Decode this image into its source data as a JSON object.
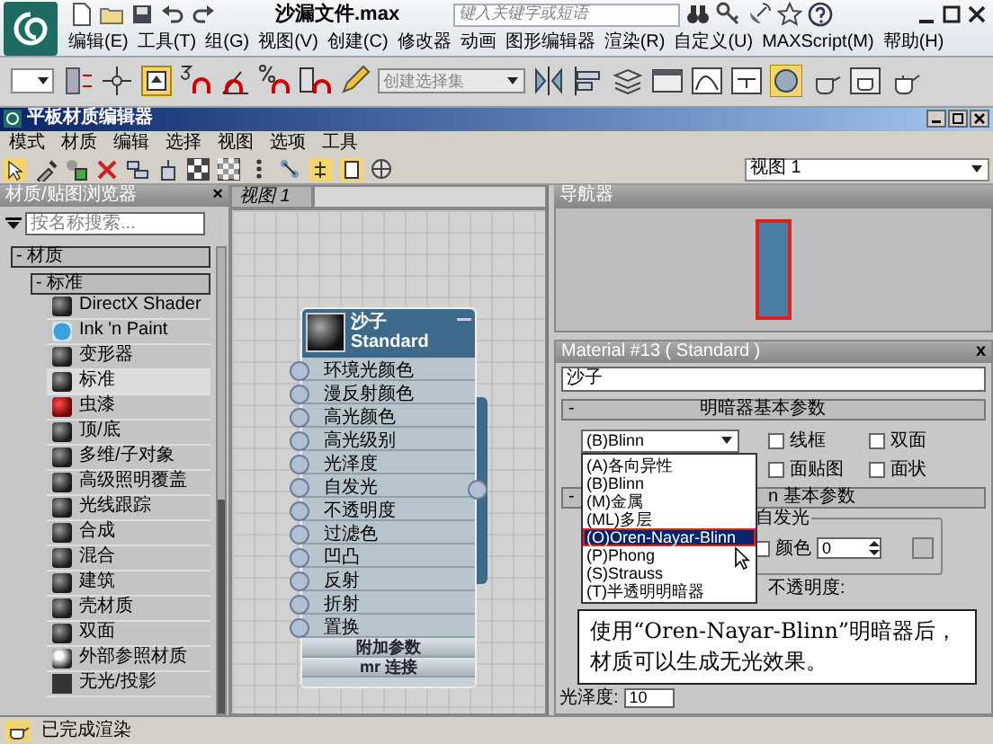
{
  "app": {
    "title": "沙漏文件.max",
    "search_placeholder": "键入关键字或短语",
    "menu": [
      "编辑(E)",
      "工具(T)",
      "组(G)",
      "视图(V)",
      "创建(C)",
      "修改器",
      "动画",
      "图形编辑器",
      "渲染(R)",
      "自定义(U)",
      "MAXScript(M)",
      "帮助(H)"
    ]
  },
  "main_toolbar": {
    "selection_set_placeholder": "创建选择集"
  },
  "editor": {
    "title": "平板材质编辑器",
    "menu": [
      "模式",
      "材质",
      "编辑",
      "选择",
      "视图",
      "选项",
      "工具"
    ],
    "view_select": "视图 1"
  },
  "browser": {
    "title": "材质/贴图浏览器",
    "close": "×",
    "search_placeholder": "按名称搜索...",
    "group": "- 材质",
    "subgroup": "- 标准",
    "items": [
      {
        "label": "DirectX Shader",
        "kind": "dark_sphere",
        "selected": false
      },
      {
        "label": "Ink 'n Paint",
        "kind": "blue_sphere",
        "selected": false
      },
      {
        "label": "变形器",
        "kind": "dark_sphere",
        "selected": false
      },
      {
        "label": "标准",
        "kind": "dark_sphere",
        "selected": true
      },
      {
        "label": "虫漆",
        "kind": "red_sphere",
        "selected": false
      },
      {
        "label": "顶/底",
        "kind": "dark_sphere",
        "selected": false
      },
      {
        "label": "多维/子对象",
        "kind": "dark_sphere",
        "selected": false
      },
      {
        "label": "高级照明覆盖",
        "kind": "dark_sphere",
        "selected": false
      },
      {
        "label": "光线跟踪",
        "kind": "dark_sphere",
        "selected": false
      },
      {
        "label": "合成",
        "kind": "dark_sphere",
        "selected": false
      },
      {
        "label": "混合",
        "kind": "dark_sphere",
        "selected": false
      },
      {
        "label": "建筑",
        "kind": "dark_sphere",
        "selected": false
      },
      {
        "label": "壳材质",
        "kind": "dark_sphere",
        "selected": false
      },
      {
        "label": "双面",
        "kind": "dark_sphere",
        "selected": false
      },
      {
        "label": "外部参照材质",
        "kind": "white_sphere",
        "selected": false
      },
      {
        "label": "无光/投影",
        "kind": "matte",
        "selected": false
      }
    ]
  },
  "view": {
    "tab": "视图 1",
    "node": {
      "title": "沙子",
      "subtitle": "Standard",
      "slots": [
        "环境光颜色",
        "漫反射颜色",
        "高光颜色",
        "高光级别",
        "光泽度",
        "自发光",
        "不透明度",
        "过滤色",
        "凹凸",
        "反射",
        "折射",
        "置换"
      ],
      "footer": [
        "附加参数",
        "mr 连接"
      ]
    }
  },
  "navigator": {
    "title": "导航器"
  },
  "params": {
    "header": "Material #13 ( Standard )",
    "close": "x",
    "name": "沙子",
    "rollout": {
      "toggle": "-",
      "title": "明暗器基本参数"
    },
    "shader": "(B)Blinn",
    "options": [
      {
        "label": "线框",
        "checked": false
      },
      {
        "label": "双面",
        "checked": false
      },
      {
        "label": "面贴图",
        "checked": false
      },
      {
        "label": "面状",
        "checked": false
      }
    ],
    "shader_list": [
      {
        "label": "(A)各向异性",
        "selected": false
      },
      {
        "label": "(B)Blinn",
        "selected": false
      },
      {
        "label": "(M)金属",
        "selected": false
      },
      {
        "label": "(ML)多层",
        "selected": false
      },
      {
        "label": "(O)Oren-Nayar-Blinn",
        "selected": true
      },
      {
        "label": "(P)Phong",
        "selected": false
      },
      {
        "label": "(S)Strauss",
        "selected": false
      },
      {
        "label": "(T)半透明明暗器",
        "selected": false
      }
    ],
    "rollout_2": {
      "toggle": "-",
      "title": "n 基本参数"
    },
    "self_illum": {
      "title": "自发光",
      "color_label": "颜色",
      "color_checked": false,
      "value": "0"
    },
    "opacity_label": "不透明度:",
    "gloss_label": "光泽度:",
    "gloss_value": "10"
  },
  "callout": {
    "text": "使用“Oren-Nayar-Blinn”明暗器后，材质可以生成无光效果。"
  },
  "status": {
    "text": "已完成渲染"
  }
}
